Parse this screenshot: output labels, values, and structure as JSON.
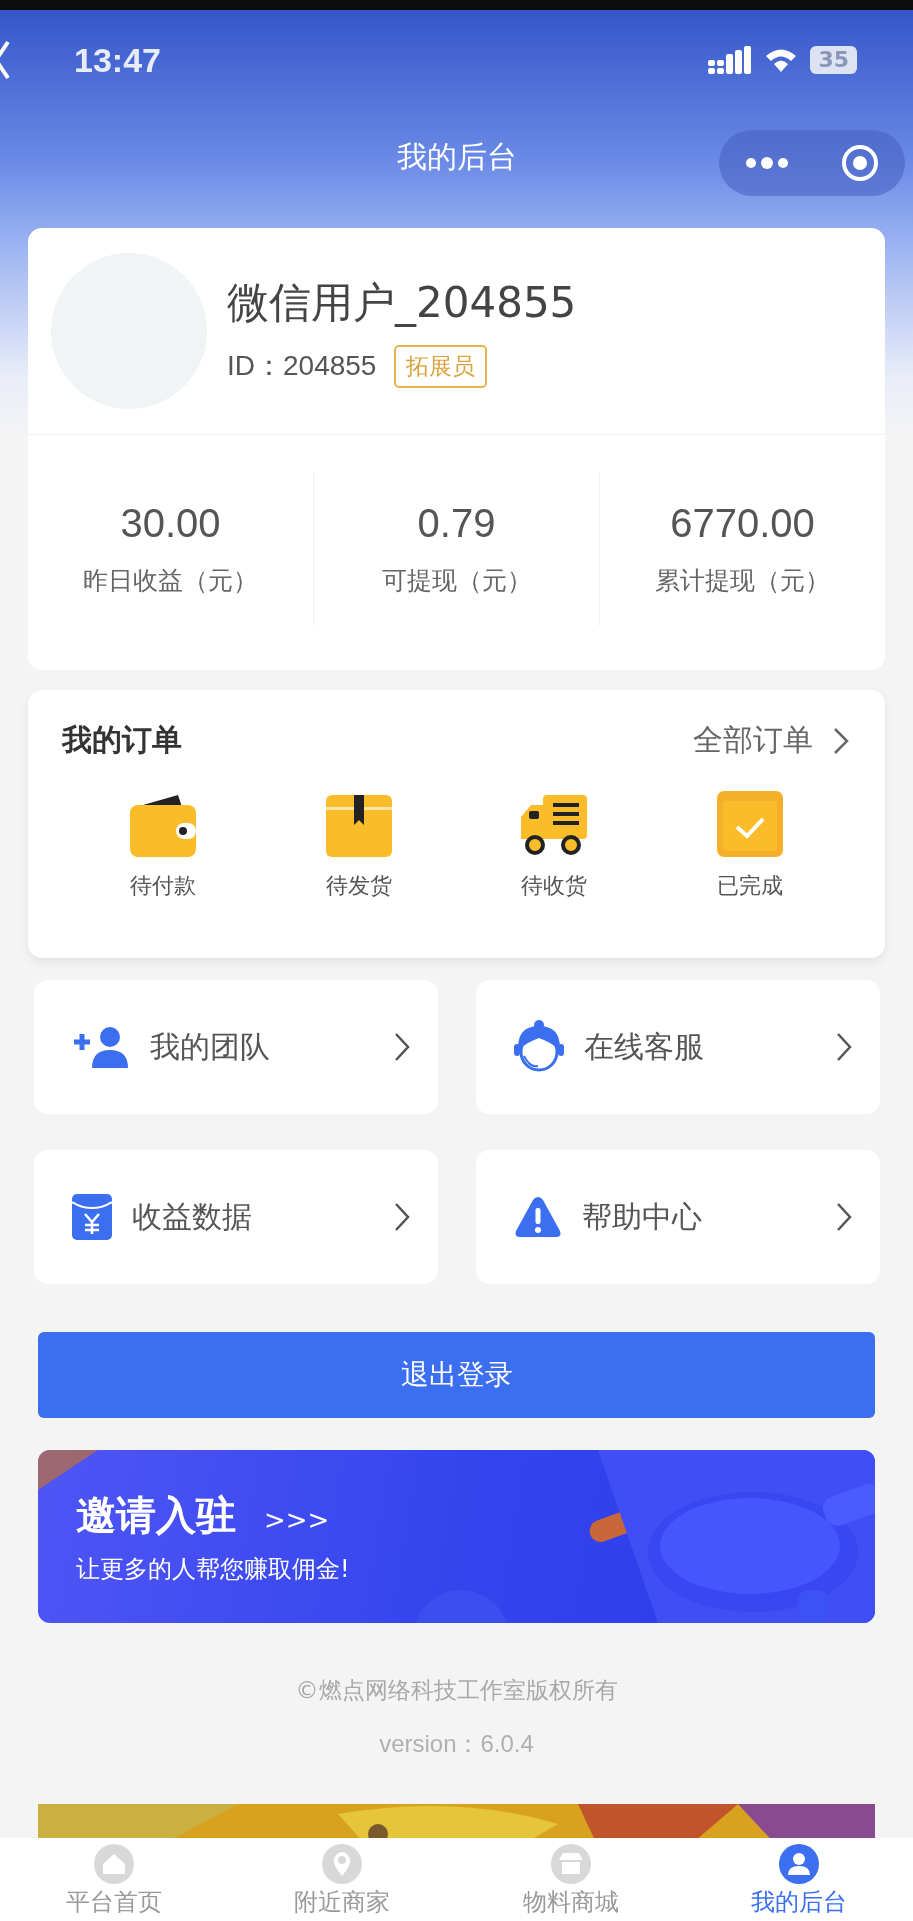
{
  "status_bar": {
    "time": "13:47",
    "battery": "35"
  },
  "nav": {
    "title": "我的后台"
  },
  "profile": {
    "name": "微信用户_204855",
    "id": "ID：204855",
    "role": "拓展员"
  },
  "stats": [
    {
      "value": "30.00",
      "label": "昨日收益（元）"
    },
    {
      "value": "0.79",
      "label": "可提现（元）"
    },
    {
      "value": "6770.00",
      "label": "累计提现（元）"
    }
  ],
  "orders": {
    "title": "我的订单",
    "all_link": "全部订单",
    "items": [
      {
        "kind": "wallet",
        "label": "待付款"
      },
      {
        "kind": "box",
        "label": "待发货"
      },
      {
        "kind": "truck",
        "label": "待收货"
      },
      {
        "kind": "done",
        "label": "已完成"
      }
    ]
  },
  "menu": [
    {
      "kind": "team",
      "label": "我的团队"
    },
    {
      "kind": "service",
      "label": "在线客服"
    },
    {
      "kind": "income",
      "label": "收益数据"
    },
    {
      "kind": "help",
      "label": "帮助中心"
    }
  ],
  "logout_button": "退出登录",
  "banner": {
    "title": "邀请入驻",
    "arrows": ">>>",
    "subtitle": "让更多的人帮您赚取佣金!"
  },
  "footer": {
    "copyright": "©燃点网络科技工作室版权所有",
    "version": "version：6.0.4"
  },
  "tab_bar": [
    {
      "kind": "home",
      "label": "平台首页",
      "selected": false
    },
    {
      "kind": "location",
      "label": "附近商家",
      "selected": false
    },
    {
      "kind": "store",
      "label": "物料商城",
      "selected": false
    },
    {
      "kind": "user",
      "label": "我的后台",
      "selected": true
    }
  ]
}
